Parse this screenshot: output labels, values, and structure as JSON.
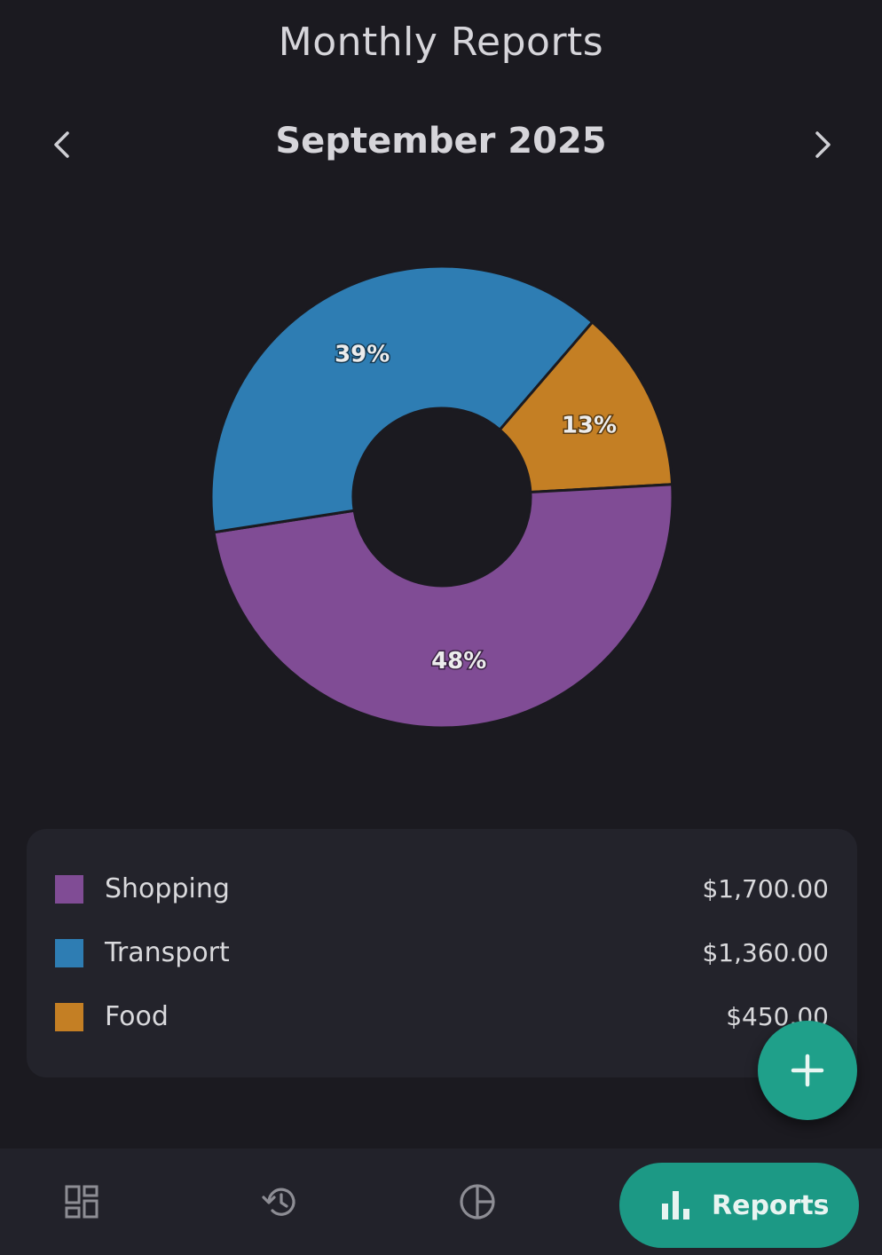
{
  "header": {
    "title": "Monthly Reports"
  },
  "month_nav": {
    "label": "September 2025",
    "prev_icon": "chevron-left-icon",
    "next_icon": "chevron-right-icon"
  },
  "chart_data": {
    "type": "pie",
    "donut": true,
    "labels": [
      "Food",
      "Shopping",
      "Transport"
    ],
    "values": [
      450.0,
      1700.0,
      1360.0
    ],
    "percent_labels": [
      "13%",
      "48%",
      "39%"
    ],
    "colors": [
      "#c47f24",
      "#804c95",
      "#2e7db3"
    ],
    "legend": "below"
  },
  "legend": {
    "items": [
      {
        "name": "Shopping",
        "amount": "$1,700.00",
        "color": "#804c95"
      },
      {
        "name": "Transport",
        "amount": "$1,360.00",
        "color": "#2e7db3"
      },
      {
        "name": "Food",
        "amount": "$450.00",
        "color": "#c47f24"
      }
    ]
  },
  "fab": {
    "icon": "plus-icon",
    "color": "#1fa08a"
  },
  "bottom_nav": {
    "items": [
      {
        "icon": "dashboard-icon"
      },
      {
        "icon": "history-icon"
      },
      {
        "icon": "budget-pie-icon"
      },
      {
        "icon": "bar-chart-icon",
        "label": "Reports",
        "active": true
      }
    ],
    "active_color": "#1c9985"
  }
}
